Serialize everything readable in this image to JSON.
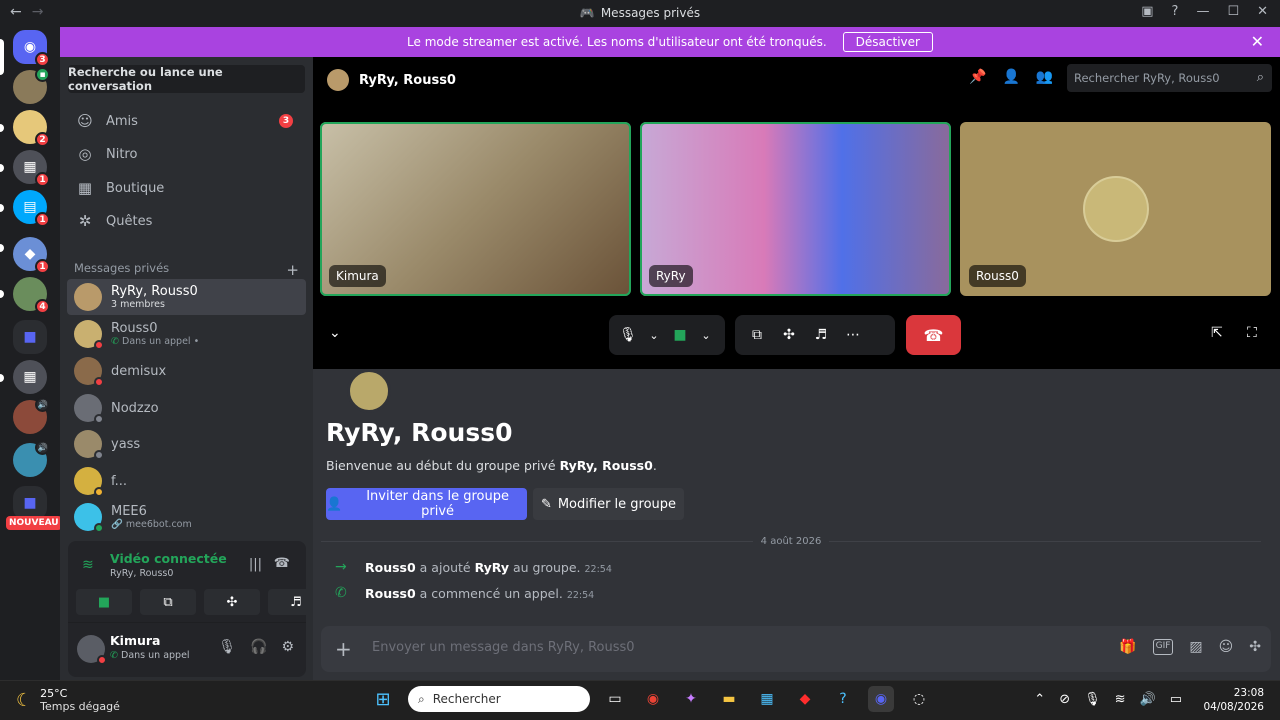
{
  "window": {
    "title": "Messages privés"
  },
  "banner": {
    "text": "Le mode streamer est activé. Les noms d'utilisateur ont été tronqués.",
    "button": "Désactiver"
  },
  "servers": [
    {
      "badge": "3"
    },
    {
      "badge": ""
    },
    {
      "badge": "2"
    },
    {
      "badge": "1"
    },
    {
      "badge": "1"
    },
    {
      "badge": "1"
    },
    {
      "badge": "4"
    }
  ],
  "server_new_label": "NOUVEAU",
  "sidebar": {
    "search": "Recherche ou lance une conversation",
    "nav": [
      {
        "label": "Amis",
        "count": "3"
      },
      {
        "label": "Nitro"
      },
      {
        "label": "Boutique"
      },
      {
        "label": "Quêtes"
      }
    ],
    "dm_header": "Messages privés",
    "dms": [
      {
        "name": "RyRy, Rouss0",
        "sub": "3 membres"
      },
      {
        "name": "Rouss0",
        "sub": "Dans un appel •"
      },
      {
        "name": "demisux",
        "sub": ""
      },
      {
        "name": "Nodzzo",
        "sub": ""
      },
      {
        "name": "yass",
        "sub": ""
      },
      {
        "name": "f...",
        "sub": ""
      },
      {
        "name": "MEE6",
        "sub": "mee6bot.com"
      }
    ]
  },
  "voice": {
    "title": "Vidéo connectée",
    "channel": "RyRy, Rouss0"
  },
  "user": {
    "name": "Kimura",
    "status": "Dans un appel"
  },
  "channel": {
    "name": "RyRy, Rouss0",
    "search_placeholder": "Rechercher RyRy, Rouss0"
  },
  "call": {
    "tiles": [
      {
        "name": "Kimura",
        "speaking": true
      },
      {
        "name": "RyRy",
        "speaking": true
      },
      {
        "name": "Rouss0",
        "speaking": false
      }
    ]
  },
  "chat": {
    "title": "RyRy, Rouss0",
    "welcome_prefix": "Bienvenue au début du groupe privé ",
    "welcome_name": "RyRy, Rouss0",
    "welcome_suffix": ".",
    "invite_button": "Inviter dans le groupe privé",
    "edit_button": "Modifier le groupe",
    "date": "4 août 2026",
    "messages": [
      {
        "actor": "Rouss0",
        "mid": " a ajouté ",
        "target": "RyRy",
        "end": " au groupe.",
        "time": "22:54"
      },
      {
        "actor": "Rouss0",
        "mid": " a commencé un appel.",
        "target": "",
        "end": "",
        "time": "22:54"
      }
    ],
    "composer_placeholder": "Envoyer un message dans RyRy, Rouss0"
  },
  "taskbar": {
    "temp": "25°C",
    "weather": "Temps dégagé",
    "search": "Rechercher",
    "time": "23:08",
    "date": "04/08/2026"
  },
  "colors": {
    "accent": "#5865f2",
    "streamer_banner": "#a943e0",
    "online": "#23a55a",
    "danger": "#da373c"
  }
}
